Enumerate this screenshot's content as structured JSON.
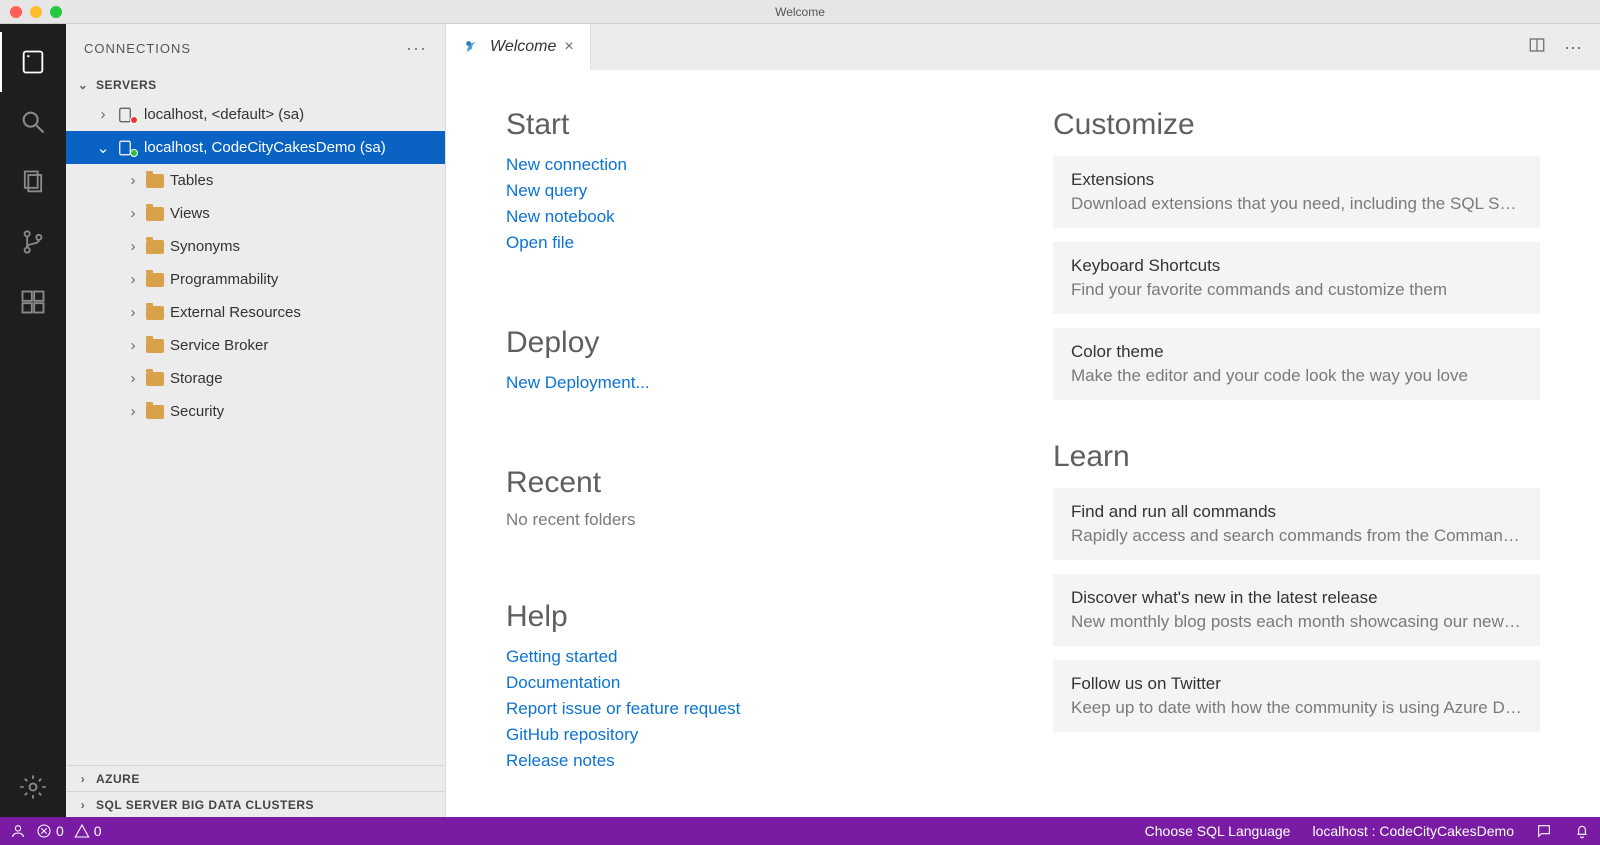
{
  "window": {
    "title": "Welcome"
  },
  "sidebar": {
    "title": "CONNECTIONS",
    "sections": {
      "servers": "SERVERS",
      "azure": "AZURE",
      "bigdata": "SQL SERVER BIG DATA CLUSTERS"
    },
    "servers": [
      {
        "label": "localhost, <default> (sa)"
      },
      {
        "label": "localhost, CodeCityCakesDemo (sa)"
      }
    ],
    "dbnodes": [
      "Tables",
      "Views",
      "Synonyms",
      "Programmability",
      "External Resources",
      "Service Broker",
      "Storage",
      "Security"
    ]
  },
  "tab": {
    "title": "Welcome"
  },
  "welcome": {
    "start": {
      "heading": "Start",
      "links": {
        "new_connection": "New connection",
        "new_query": "New query",
        "new_notebook": "New notebook",
        "open_file": "Open file"
      }
    },
    "deploy": {
      "heading": "Deploy",
      "links": {
        "new_deployment": "New Deployment..."
      }
    },
    "recent": {
      "heading": "Recent",
      "empty": "No recent folders"
    },
    "help": {
      "heading": "Help",
      "links": {
        "getting_started": "Getting started",
        "documentation": "Documentation",
        "report_issue": "Report issue or feature request",
        "github": "GitHub repository",
        "release_notes": "Release notes"
      }
    },
    "customize": {
      "heading": "Customize",
      "cards": [
        {
          "title": "Extensions",
          "desc": "Download extensions that you need, including the SQL Serv..."
        },
        {
          "title": "Keyboard Shortcuts",
          "desc": "Find your favorite commands and customize them"
        },
        {
          "title": "Color theme",
          "desc": "Make the editor and your code look the way you love"
        }
      ]
    },
    "learn": {
      "heading": "Learn",
      "cards": [
        {
          "title": "Find and run all commands",
          "desc": "Rapidly access and search commands from the Command P..."
        },
        {
          "title": "Discover what's new in the latest release",
          "desc": "New monthly blog posts each month showcasing our new fe..."
        },
        {
          "title": "Follow us on Twitter",
          "desc": "Keep up to date with how the community is using Azure Dat..."
        }
      ]
    }
  },
  "statusbar": {
    "errors": "0",
    "warnings": "0",
    "choose_lang": "Choose SQL Language",
    "connection": "localhost : CodeCityCakesDemo"
  }
}
